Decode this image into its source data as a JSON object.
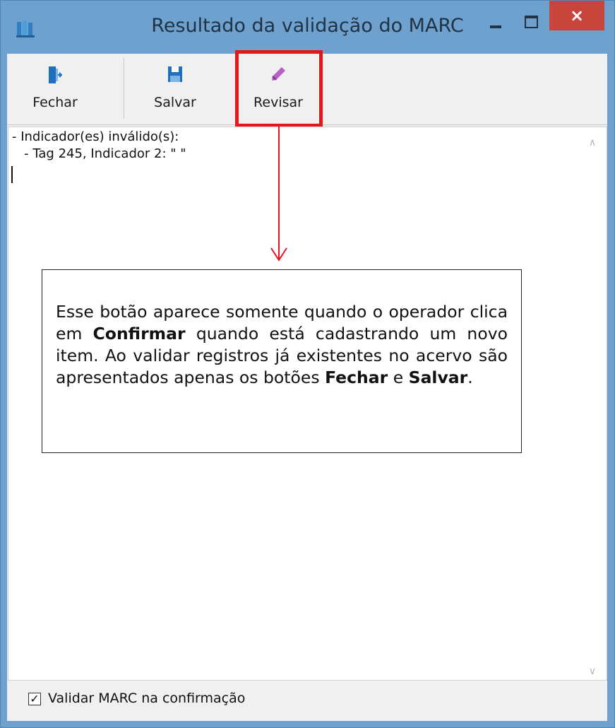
{
  "window": {
    "title": "Resultado da validação do MARC",
    "minimize_glyph": "",
    "maximize_glyph": "",
    "close_glyph": "×"
  },
  "toolbar": {
    "buttons": [
      {
        "label": "Fechar",
        "icon": "exit-door-icon",
        "color": "#1f6fbf"
      },
      {
        "label": "Salvar",
        "icon": "floppy-disk-icon",
        "color": "#1f6fbf"
      },
      {
        "label": "Revisar",
        "icon": "pencil-icon",
        "color": "#b55fc7"
      }
    ],
    "highlight_color": "#e3161c"
  },
  "result": {
    "lines": [
      "- Indicador(es) inválido(s):",
      "   - Tag 245, Indicador 2: \" \""
    ]
  },
  "callout": {
    "t1": "Esse botão aparece somente quando o operador clica em ",
    "b1": "Confirmar",
    "t2": " quando está cadastrando um novo item. Ao validar registros já existentes no acervo são apresentados apenas os botões ",
    "b2": "Fechar",
    "t3": " e ",
    "b3": "Salvar",
    "t4": "."
  },
  "footer": {
    "checkbox_checked": true,
    "checkbox_mark": "✓",
    "checkbox_label": "Validar MARC na confirmação"
  }
}
